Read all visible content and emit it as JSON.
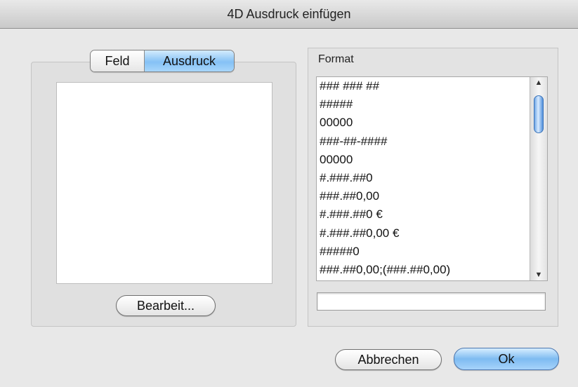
{
  "window": {
    "title": "4D Ausdruck einfügen"
  },
  "tabs": {
    "field_label": "Feld",
    "expression_label": "Ausdruck"
  },
  "expression": {
    "edit_button_label": "Bearbeit..."
  },
  "format": {
    "label": "Format",
    "items": [
      "### ### ##",
      "#####",
      "00000",
      "###-##-####",
      "00000",
      "#.###.##0",
      "###.##0,00",
      "#.###.##0 €",
      "#.###.##0,00 €",
      "#####0",
      "###.##0,00;(###.##0,00)"
    ],
    "input_value": ""
  },
  "buttons": {
    "cancel_label": "Abbrechen",
    "ok_label": "Ok"
  },
  "icons": {
    "scroll_up": "triangle-up-icon",
    "scroll_down": "triangle-down-icon"
  },
  "colors": {
    "accent": "#85c1f5",
    "default_button": "#7ebbf1"
  }
}
